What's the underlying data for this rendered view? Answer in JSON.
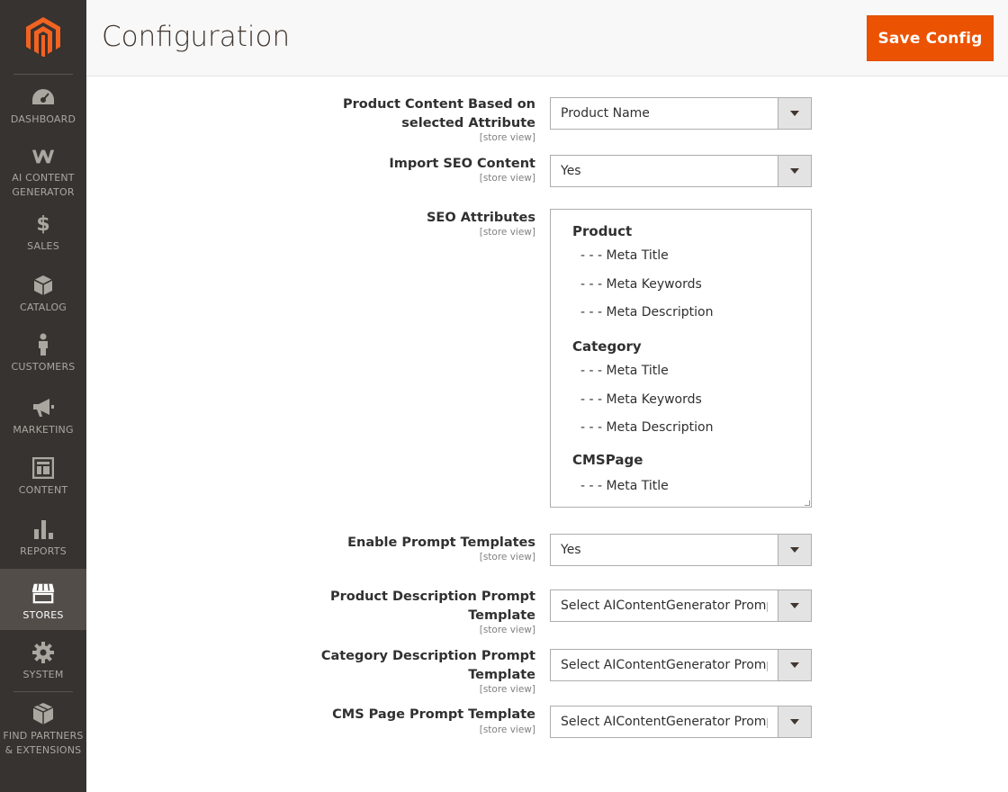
{
  "header": {
    "title": "Configuration",
    "save_label": "Save Config"
  },
  "colors": {
    "sidebar_bg": "#373330",
    "sidebar_active_bg": "#524d49",
    "accent": "#eb5202",
    "logo": "#f26322"
  },
  "sidebar": {
    "items": [
      {
        "label": "DASHBOARD",
        "icon": "dashboard-icon"
      },
      {
        "label": "AI CONTENT GENERATOR",
        "icon": "ai-content-generator-icon"
      },
      {
        "label": "SALES",
        "icon": "dollar-icon"
      },
      {
        "label": "CATALOG",
        "icon": "cube-icon"
      },
      {
        "label": "CUSTOMERS",
        "icon": "person-icon"
      },
      {
        "label": "MARKETING",
        "icon": "megaphone-icon"
      },
      {
        "label": "CONTENT",
        "icon": "layout-icon"
      },
      {
        "label": "REPORTS",
        "icon": "bar-chart-icon"
      },
      {
        "label": "STORES",
        "icon": "storefront-icon",
        "active": true
      },
      {
        "label": "SYSTEM",
        "icon": "gear-icon"
      },
      {
        "label": "FIND PARTNERS & EXTENSIONS",
        "icon": "extensions-icon"
      }
    ]
  },
  "form": {
    "fields": [
      {
        "label": "Product Content Based on selected Attribute",
        "scope": "[store view]",
        "value": "Product Name"
      },
      {
        "label": "Import SEO Content",
        "scope": "[store view]",
        "value": "Yes"
      },
      {
        "label": "SEO Attributes",
        "scope": "[store view]"
      },
      {
        "label": "Enable Prompt Templates",
        "scope": "[store view]",
        "value": "Yes"
      },
      {
        "label": "Product Description Prompt Template",
        "scope": "[store view]",
        "value": "Select AIContentGenerator Prompt"
      },
      {
        "label": "Category Description Prompt Template",
        "scope": "[store view]",
        "value": "Select AIContentGenerator Prompt"
      },
      {
        "label": "CMS Page Prompt Template",
        "scope": "[store view]",
        "value": "Select AIContentGenerator Prompt"
      }
    ],
    "seo_attributes": {
      "groups": [
        {
          "label": "Product",
          "options": [
            "- - - Meta Title",
            "- - - Meta Keywords",
            "- - - Meta Description"
          ]
        },
        {
          "label": "Category",
          "options": [
            "- - - Meta Title",
            "- - - Meta Keywords",
            "- - - Meta Description"
          ]
        },
        {
          "label": "CMSPage",
          "options": [
            "- - - Meta Title"
          ]
        }
      ]
    }
  }
}
